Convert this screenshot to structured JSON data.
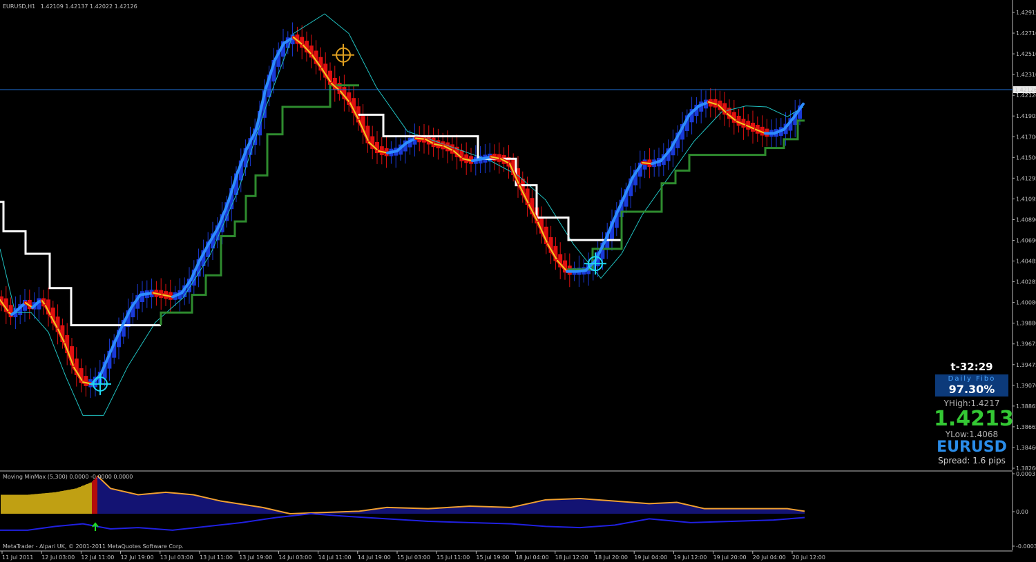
{
  "header": {
    "symbol_timeframe": "EURUSD,H1",
    "ohlc": "1.42109 1.42137 1.42022 1.42126"
  },
  "price_axis": {
    "labels": [
      "1.42915",
      "1.42710",
      "1.42510",
      "1.42310",
      "1.42126",
      "1.41905",
      "1.41700",
      "1.41500",
      "1.41295",
      "1.41095",
      "1.40890",
      "1.40690",
      "1.40485",
      "1.40285",
      "1.40080",
      "1.39880",
      "1.39675",
      "1.39475",
      "1.39070",
      "1.38865",
      "1.38665",
      "1.38460",
      "1.38260"
    ],
    "current_price_label": "1.42126"
  },
  "time_axis": {
    "labels": [
      "11 Jul 2011",
      "12 Jul 03:00",
      "12 Jul 11:00",
      "12 Jul 19:00",
      "13 Jul 03:00",
      "13 Jul 11:00",
      "13 Jul 19:00",
      "14 Jul 03:00",
      "14 Jul 11:00",
      "14 Jul 19:00",
      "15 Jul 03:00",
      "15 Jul 11:00",
      "15 Jul 19:00",
      "18 Jul 04:00",
      "18 Jul 12:00",
      "18 Jul 20:00",
      "19 Jul 04:00",
      "19 Jul 12:00",
      "19 Jul 20:00",
      "20 Jul 04:00",
      "20 Jul 12:00"
    ]
  },
  "info_panel": {
    "timer": "t-32:29",
    "fibo_title": "Daily Fibo",
    "fibo_percent": "97.30%",
    "yhigh": "YHigh:1.4217",
    "price": "1.4213",
    "ylow": "YLow:1.4068",
    "symbol": "EURUSD",
    "spread": "Spread: 1.6 pips"
  },
  "sub_window": {
    "title": "Moving MinMax (5,300) 0.0000 -0.0000 0.0000",
    "axis": [
      "0.0003",
      "0.00",
      "-0.0003"
    ]
  },
  "footer": {
    "copyright": "MetaTrader - Alpari UK, © 2001-2011 MetaQuotes Software Corp."
  },
  "colors": {
    "background": "#000000",
    "bull_candle": "#1a3ad8",
    "bear_candle": "#e01010",
    "bull_line": "#2d8cff",
    "bear_line": "#f0d020",
    "envelope": "#20c0c0",
    "upper_stair": "#ffffff",
    "lower_stair": "#2e8b2e",
    "price_line": "#1e6fd8",
    "fibo_box": "#0c3a7a",
    "price_big": "#34c834",
    "symbol_big": "#2a8ce8",
    "hist_yellow": "#f0c818",
    "hist_blue": "#181890",
    "hist_red": "#e01010",
    "osc_orange": "#f0a030",
    "osc_blue": "#2020e0",
    "arrow": "#20e020"
  },
  "chart_data": {
    "type": "line",
    "symbol": "EURUSD",
    "timeframe": "H1",
    "ylim": [
      1.3826,
      1.4302
    ],
    "price_path": [
      [
        0,
        1.3998
      ],
      [
        13,
        1.3985
      ],
      [
        17,
        1.3983
      ],
      [
        21,
        1.3985
      ],
      [
        32,
        1.3992
      ],
      [
        37,
        1.3995
      ],
      [
        47,
        1.399
      ],
      [
        56,
        1.3996
      ],
      [
        61,
        1.3997
      ],
      [
        66,
        1.3992
      ],
      [
        74,
        1.3981
      ],
      [
        84,
        1.3968
      ],
      [
        94,
        1.3953
      ],
      [
        107,
        1.3929
      ],
      [
        120,
        1.3914
      ],
      [
        133,
        1.3912
      ],
      [
        146,
        1.3922
      ],
      [
        160,
        1.3945
      ],
      [
        174,
        1.3967
      ],
      [
        190,
        1.399
      ],
      [
        203,
        1.4003
      ],
      [
        212,
        1.4004
      ],
      [
        222,
        1.4005
      ],
      [
        236,
        1.4003
      ],
      [
        250,
        1.4001
      ],
      [
        263,
        1.4005
      ],
      [
        276,
        1.4018
      ],
      [
        289,
        1.4038
      ],
      [
        302,
        1.4055
      ],
      [
        316,
        1.4072
      ],
      [
        330,
        1.4097
      ],
      [
        344,
        1.4128
      ],
      [
        357,
        1.4152
      ],
      [
        371,
        1.4172
      ],
      [
        384,
        1.4212
      ],
      [
        398,
        1.4243
      ],
      [
        411,
        1.426
      ],
      [
        425,
        1.4266
      ],
      [
        439,
        1.4258
      ],
      [
        452,
        1.4248
      ],
      [
        466,
        1.4234
      ],
      [
        480,
        1.4219
      ],
      [
        493,
        1.4211
      ],
      [
        507,
        1.4199
      ],
      [
        520,
        1.4181
      ],
      [
        534,
        1.4159
      ],
      [
        548,
        1.415
      ],
      [
        561,
        1.4148
      ],
      [
        575,
        1.415
      ],
      [
        588,
        1.4158
      ],
      [
        602,
        1.4163
      ],
      [
        616,
        1.4162
      ],
      [
        629,
        1.4157
      ],
      [
        643,
        1.4155
      ],
      [
        657,
        1.415
      ],
      [
        670,
        1.4142
      ],
      [
        684,
        1.414
      ],
      [
        698,
        1.4142
      ],
      [
        711,
        1.4144
      ],
      [
        725,
        1.4142
      ],
      [
        738,
        1.4137
      ],
      [
        752,
        1.4115
      ],
      [
        766,
        1.4095
      ],
      [
        779,
        1.4077
      ],
      [
        793,
        1.4055
      ],
      [
        807,
        1.4038
      ],
      [
        821,
        1.4027
      ],
      [
        835,
        1.4027
      ],
      [
        848,
        1.4028
      ],
      [
        862,
        1.4038
      ],
      [
        876,
        1.4058
      ],
      [
        889,
        1.408
      ],
      [
        903,
        1.4102
      ],
      [
        916,
        1.4123
      ],
      [
        930,
        1.4138
      ],
      [
        944,
        1.4137
      ],
      [
        957,
        1.414
      ],
      [
        971,
        1.4152
      ],
      [
        985,
        1.417
      ],
      [
        998,
        1.4187
      ],
      [
        1012,
        1.4196
      ],
      [
        1026,
        1.42
      ],
      [
        1040,
        1.4197
      ],
      [
        1053,
        1.4188
      ],
      [
        1067,
        1.418
      ],
      [
        1081,
        1.4176
      ],
      [
        1094,
        1.4172
      ],
      [
        1108,
        1.4168
      ],
      [
        1121,
        1.4168
      ],
      [
        1135,
        1.4172
      ],
      [
        1149,
        1.4184
      ],
      [
        1163,
        1.4198
      ]
    ],
    "envelope_path": [
      [
        0,
        1.405
      ],
      [
        22,
        1.3985
      ],
      [
        45,
        1.3985
      ],
      [
        70,
        1.3965
      ],
      [
        95,
        1.392
      ],
      [
        120,
        1.388
      ],
      [
        150,
        1.388
      ],
      [
        185,
        1.393
      ],
      [
        225,
        1.3975
      ],
      [
        265,
        1.4
      ],
      [
        305,
        1.4045
      ],
      [
        345,
        1.411
      ],
      [
        385,
        1.4195
      ],
      [
        425,
        1.427
      ],
      [
        470,
        1.429
      ],
      [
        505,
        1.427
      ],
      [
        545,
        1.4215
      ],
      [
        590,
        1.417
      ],
      [
        630,
        1.416
      ],
      [
        670,
        1.415
      ],
      [
        710,
        1.414
      ],
      [
        750,
        1.4125
      ],
      [
        790,
        1.41
      ],
      [
        830,
        1.4055
      ],
      [
        870,
        1.402
      ],
      [
        900,
        1.4045
      ],
      [
        930,
        1.4085
      ],
      [
        965,
        1.412
      ],
      [
        1005,
        1.416
      ],
      [
        1045,
        1.419
      ],
      [
        1080,
        1.4196
      ],
      [
        1110,
        1.4195
      ],
      [
        1140,
        1.4185
      ],
      [
        1163,
        1.4195
      ]
    ],
    "upper_stair": [
      [
        0,
        1.4098
      ],
      [
        5,
        1.4098
      ],
      [
        5,
        1.4068
      ],
      [
        37,
        1.4068
      ],
      [
        37,
        1.4045
      ],
      [
        72,
        1.4045
      ],
      [
        72,
        1.401
      ],
      [
        103,
        1.401
      ],
      [
        103,
        1.3972
      ],
      [
        233,
        1.3972
      ]
    ],
    "upper_stair_2": [
      [
        520,
        1.4188
      ],
      [
        520,
        1.4187
      ],
      [
        555,
        1.4187
      ],
      [
        555,
        1.4165
      ],
      [
        692,
        1.4165
      ],
      [
        692,
        1.4142
      ],
      [
        747,
        1.4142
      ],
      [
        747,
        1.4115
      ],
      [
        777,
        1.4115
      ],
      [
        777,
        1.4082
      ],
      [
        823,
        1.4082
      ],
      [
        823,
        1.4059
      ],
      [
        900,
        1.4059
      ]
    ],
    "lower_stair": [
      [
        233,
        1.3972
      ],
      [
        233,
        1.3985
      ],
      [
        278,
        1.3985
      ],
      [
        278,
        1.4003
      ],
      [
        298,
        1.4003
      ],
      [
        298,
        1.4023
      ],
      [
        320,
        1.4023
      ],
      [
        320,
        1.4063
      ],
      [
        340,
        1.4063
      ],
      [
        340,
        1.4078
      ],
      [
        356,
        1.4078
      ],
      [
        356,
        1.4104
      ],
      [
        370,
        1.4104
      ],
      [
        370,
        1.4125
      ],
      [
        387,
        1.4125
      ],
      [
        387,
        1.4167
      ],
      [
        409,
        1.4167
      ],
      [
        409,
        1.4195
      ],
      [
        478,
        1.4195
      ],
      [
        478,
        1.4217
      ],
      [
        520,
        1.4217
      ]
    ],
    "lower_stair_2": [
      [
        820,
        1.4029
      ],
      [
        858,
        1.4029
      ],
      [
        858,
        1.405
      ],
      [
        900,
        1.405
      ],
      [
        900,
        1.4088
      ],
      [
        958,
        1.4088
      ],
      [
        958,
        1.4117
      ],
      [
        978,
        1.4117
      ],
      [
        978,
        1.413
      ],
      [
        998,
        1.413
      ],
      [
        998,
        1.4146
      ],
      [
        1108,
        1.4146
      ],
      [
        1108,
        1.4153
      ],
      [
        1135,
        1.4153
      ],
      [
        1135,
        1.4162
      ],
      [
        1155,
        1.4162
      ],
      [
        1155,
        1.4181
      ],
      [
        1165,
        1.4181
      ]
    ],
    "current_price": 1.42126,
    "signals": [
      {
        "type": "buy",
        "x": 145,
        "price": 1.3912,
        "color": "#20d8f0"
      },
      {
        "type": "sell",
        "x": 497,
        "price": 1.4248,
        "color": "#e0a020"
      },
      {
        "type": "buy",
        "x": 862,
        "price": 1.4035,
        "color": "#20d8f0"
      }
    ],
    "oscillator": {
      "range": [
        -0.0003,
        0.0003
      ],
      "histogram_yellow_end": 133,
      "histogram_red_end": 141,
      "histogram_path": [
        [
          0,
          0.00015
        ],
        [
          40,
          0.00015
        ],
        [
          80,
          0.00017
        ],
        [
          110,
          0.0002
        ],
        [
          133,
          0.00025
        ],
        [
          141,
          0.0003
        ],
        [
          160,
          0.0002
        ],
        [
          200,
          0.00015
        ],
        [
          240,
          0.00017
        ],
        [
          280,
          0.00015
        ],
        [
          320,
          0.0001
        ],
        [
          380,
          5e-05
        ],
        [
          420,
          0.0
        ],
        [
          470,
          1e-05
        ],
        [
          520,
          2e-05
        ],
        [
          560,
          5e-05
        ],
        [
          620,
          4e-05
        ],
        [
          680,
          6e-05
        ],
        [
          740,
          5e-05
        ],
        [
          790,
          0.00011
        ],
        [
          840,
          0.00012
        ],
        [
          890,
          0.0001
        ],
        [
          940,
          8e-05
        ],
        [
          980,
          9e-05
        ],
        [
          1020,
          4e-05
        ],
        [
          1080,
          4e-05
        ],
        [
          1140,
          4e-05
        ],
        [
          1165,
          2e-05
        ]
      ],
      "orange_line": [
        [
          141,
          0.0003
        ],
        [
          160,
          0.0002
        ],
        [
          200,
          0.00015
        ],
        [
          240,
          0.00017
        ],
        [
          280,
          0.00015
        ],
        [
          320,
          0.0001
        ],
        [
          380,
          5e-05
        ],
        [
          420,
          0.0
        ],
        [
          470,
          1e-05
        ],
        [
          520,
          2e-05
        ],
        [
          560,
          5e-05
        ],
        [
          620,
          4e-05
        ],
        [
          680,
          6e-05
        ],
        [
          740,
          5e-05
        ],
        [
          790,
          0.00011
        ],
        [
          840,
          0.00012
        ],
        [
          890,
          0.0001
        ],
        [
          940,
          8e-05
        ],
        [
          980,
          9e-05
        ],
        [
          1020,
          4e-05
        ],
        [
          1080,
          4e-05
        ],
        [
          1140,
          4e-05
        ],
        [
          1165,
          2e-05
        ]
      ],
      "blue_line": [
        [
          0,
          -0.00013
        ],
        [
          40,
          -0.00013
        ],
        [
          80,
          -0.0001
        ],
        [
          120,
          -8e-05
        ],
        [
          160,
          -0.00012
        ],
        [
          200,
          -0.00011
        ],
        [
          250,
          -0.00013
        ],
        [
          300,
          -0.0001
        ],
        [
          350,
          -7e-05
        ],
        [
          400,
          -3e-05
        ],
        [
          450,
          -0.0
        ],
        [
          500,
          -2e-05
        ],
        [
          560,
          -4e-05
        ],
        [
          620,
          -6e-05
        ],
        [
          680,
          -7e-05
        ],
        [
          740,
          -8e-05
        ],
        [
          790,
          -0.0001
        ],
        [
          840,
          -0.00011
        ],
        [
          890,
          -9e-05
        ],
        [
          940,
          -4e-05
        ],
        [
          1000,
          -7e-05
        ],
        [
          1060,
          -6e-05
        ],
        [
          1120,
          -5e-05
        ],
        [
          1165,
          -3e-05
        ]
      ]
    }
  }
}
